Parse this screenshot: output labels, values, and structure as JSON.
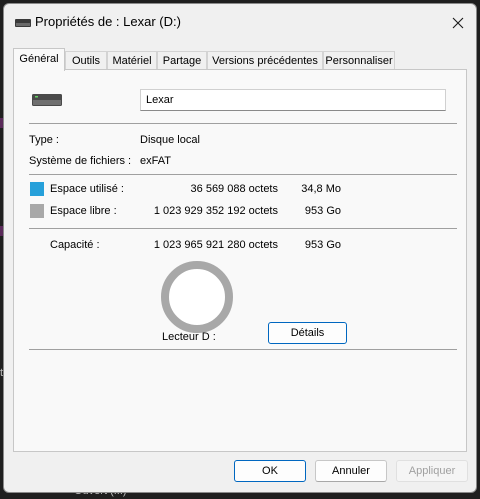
{
  "window": {
    "title": "Propriétés de : Lexar (D:)"
  },
  "tabs": [
    "Général",
    "Outils",
    "Matériel",
    "Partage",
    "Versions précédentes",
    "Personnaliser"
  ],
  "general": {
    "name_value": "Lexar",
    "type_label": "Type :",
    "type_value": "Disque local",
    "fs_label": "Système de fichiers :",
    "fs_value": "exFAT",
    "used_label": "Espace utilisé :",
    "used_bytes": "36 569 088 octets",
    "used_short": "34,8 Mo",
    "free_label": "Espace libre :",
    "free_bytes": "1 023 929 352 192 octets",
    "free_short": "953 Go",
    "capacity_label": "Capacité :",
    "capacity_bytes": "1 023 965 921 280 octets",
    "capacity_short": "953 Go",
    "drive_label": "Lecteur D :",
    "details_button": "Détails",
    "used_fraction": 3.57e-05
  },
  "colors": {
    "used": "#26a0da",
    "free": "#a8a8a8"
  },
  "footer": {
    "ok": "OK",
    "cancel": "Annuler",
    "apply": "Appliquer"
  },
  "background": {
    "partial_text": "Ouvert (...)",
    "partial_letter": "t"
  }
}
